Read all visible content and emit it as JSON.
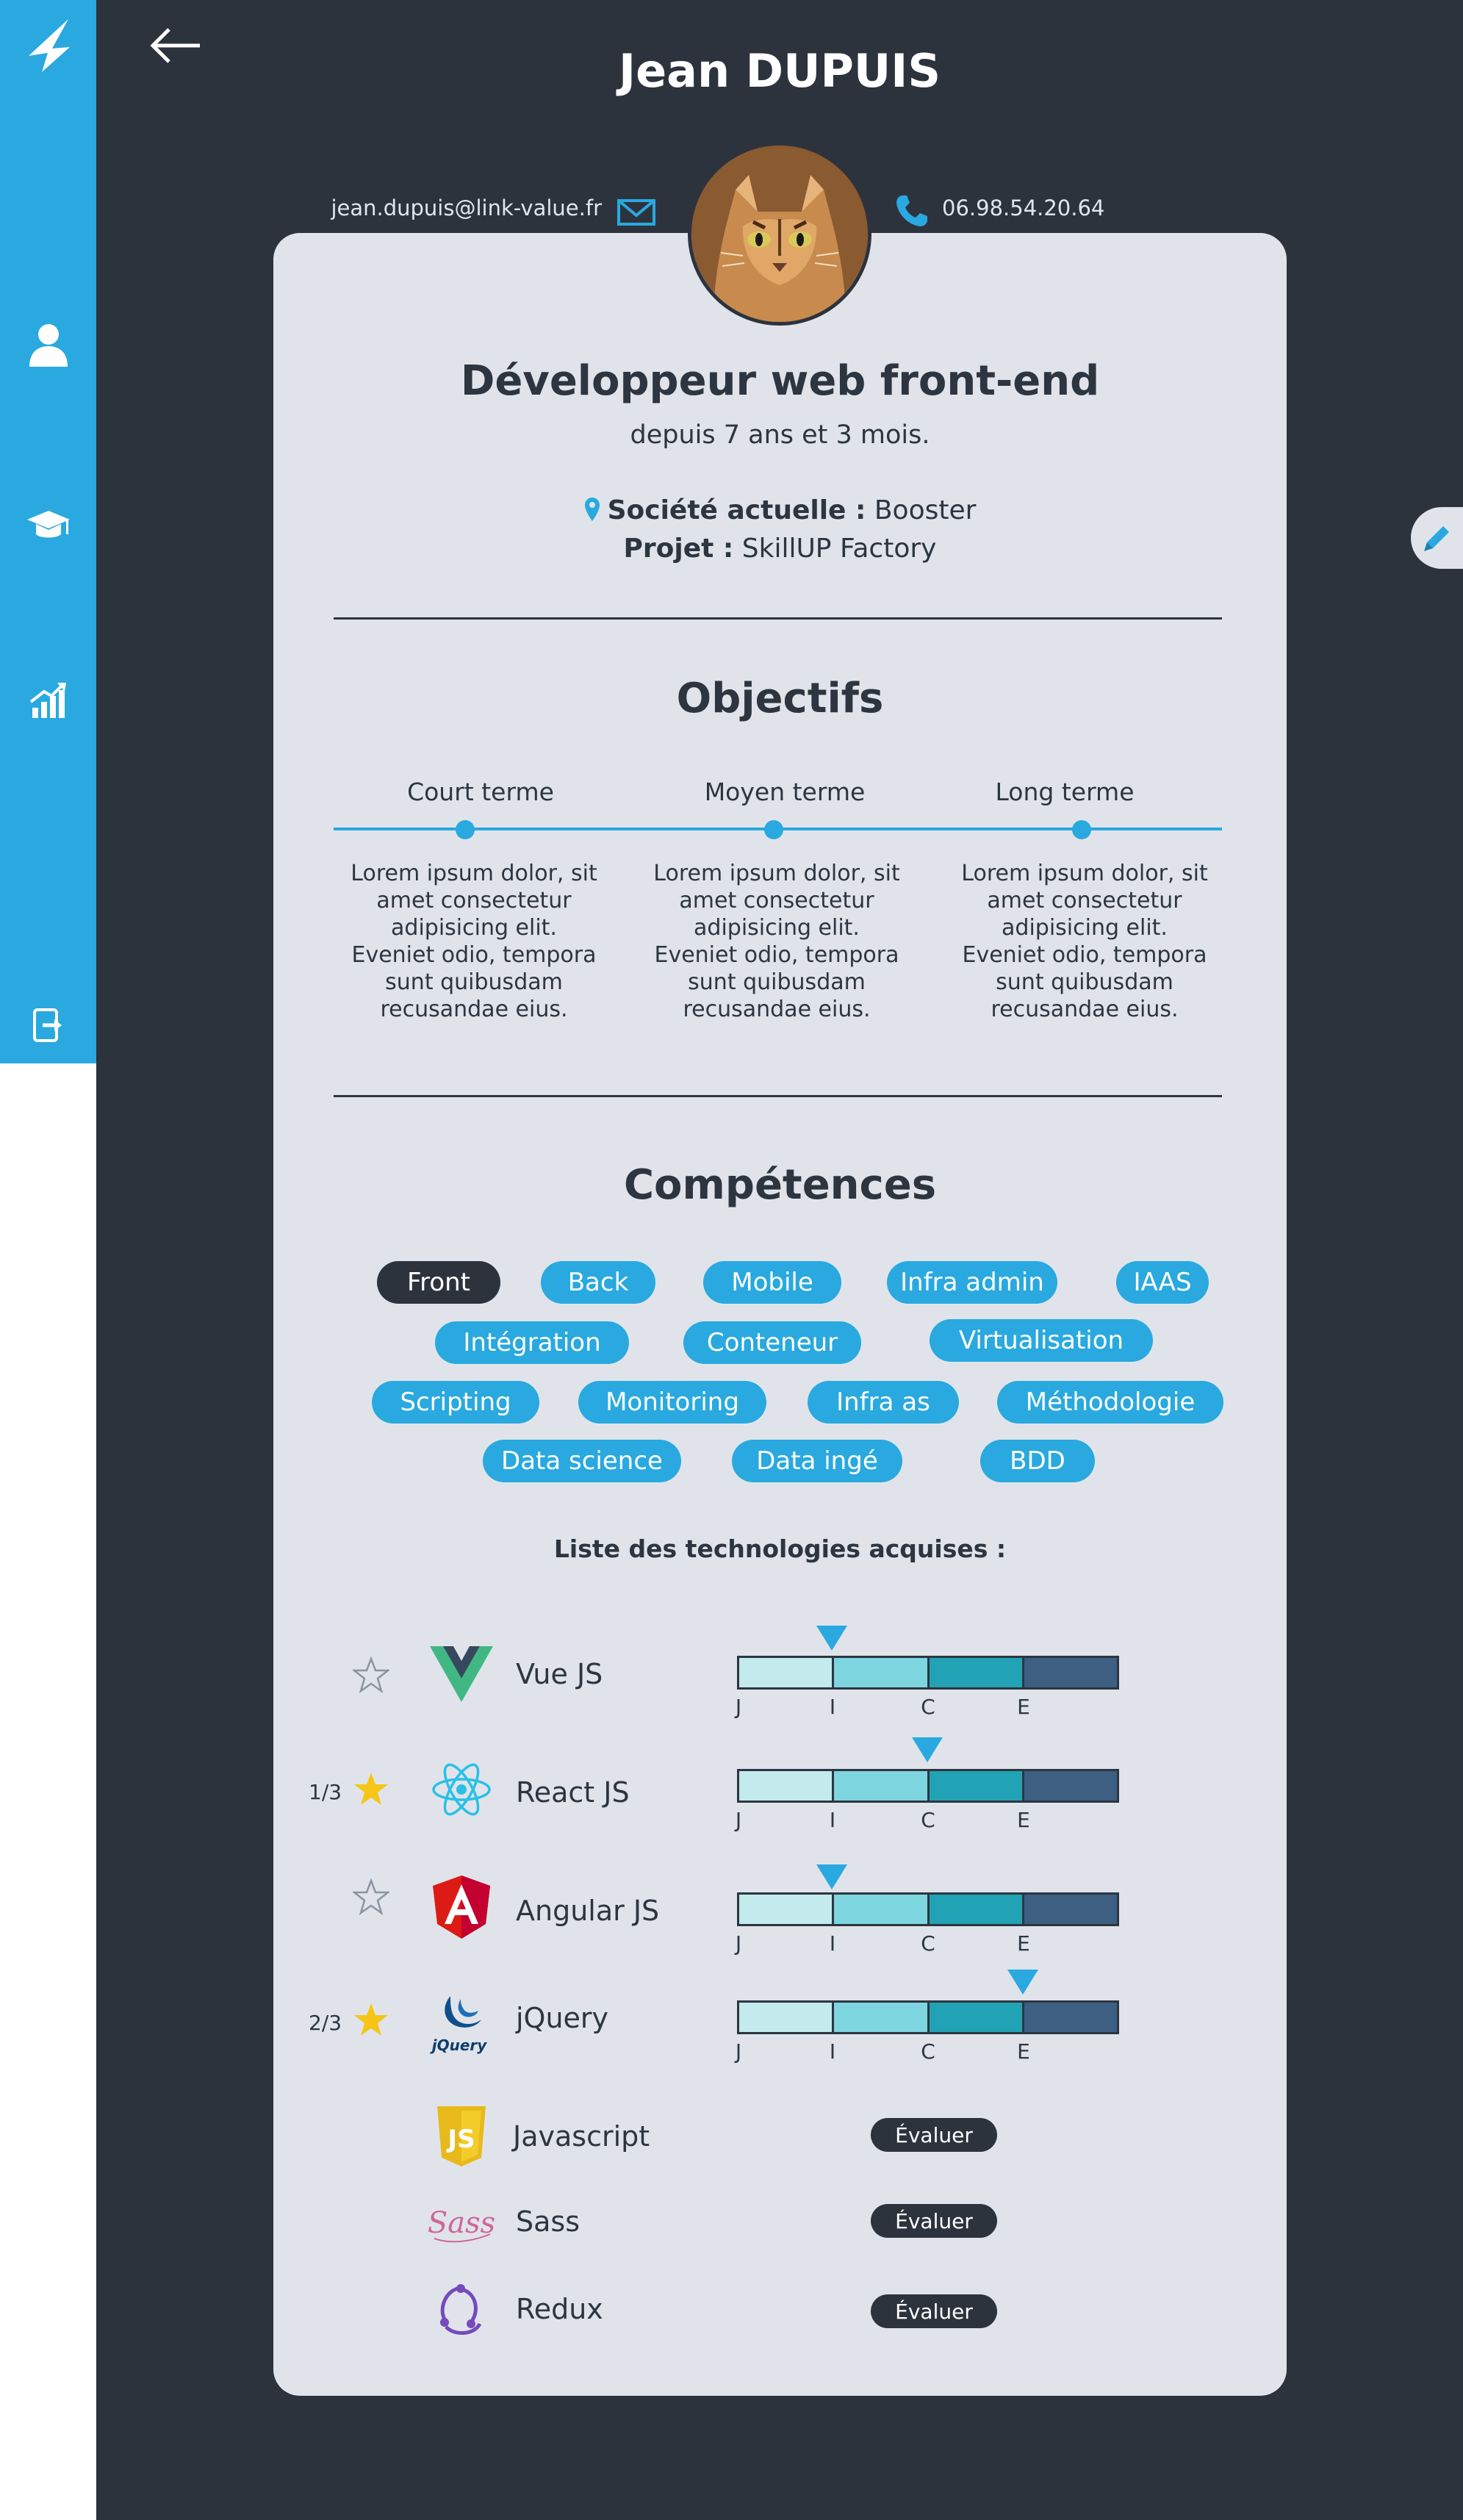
{
  "header": {
    "name": "Jean DUPUIS"
  },
  "contact": {
    "email": "jean.dupuis@link-value.fr",
    "phone": "06.98.54.20.64"
  },
  "profile": {
    "job_title": "Développeur web front-end",
    "experience": "depuis 7 ans et 3 mois.",
    "company_label": "Société actuelle :",
    "company_value": " Booster",
    "project_label": "Projet :",
    "project_value": " SkillUP Factory"
  },
  "objectives": {
    "title": "Objectifs",
    "terms": [
      {
        "label": "Court terme",
        "text": "Lorem ipsum dolor, sit amet consectetur adipisicing elit. Eveniet odio, tempora sunt quibusdam recusandae eius."
      },
      {
        "label": "Moyen terme",
        "text": "Lorem ipsum dolor, sit amet consectetur adipisicing elit. Eveniet odio, tempora sunt quibusdam recusandae eius."
      },
      {
        "label": "Long terme",
        "text": "Lorem ipsum dolor, sit amet consectetur adipisicing elit. Eveniet odio, tempora sunt quibusdam recusandae eius."
      }
    ]
  },
  "skills": {
    "title": "Compétences",
    "categories": [
      "Front",
      "Back",
      "Mobile",
      "Infra admin",
      "IAAS",
      "Intégration",
      "Conteneur",
      "Virtualisation",
      "Scripting",
      "Monitoring",
      "Infra as",
      "Méthodologie",
      "Data science",
      "Data ingé",
      "BDD"
    ],
    "active": "Front"
  },
  "technologies": {
    "title": "Liste des technologies acquises :",
    "level_labels": [
      "J",
      "I",
      "C",
      "E"
    ],
    "evaluate_label": "Évaluer",
    "rated": [
      {
        "name": "Vue JS",
        "icon": "vue-logo-icon",
        "level": 2,
        "favorite": false,
        "fav_count": ""
      },
      {
        "name": "React JS",
        "icon": "react-logo-icon",
        "level": 3,
        "favorite": true,
        "fav_count": "1/3"
      },
      {
        "name": "Angular JS",
        "icon": "angular-logo-icon",
        "level": 2,
        "favorite": false,
        "fav_count": ""
      },
      {
        "name": "jQuery",
        "icon": "jquery-logo-icon",
        "level": 4,
        "favorite": true,
        "fav_count": "2/3"
      }
    ],
    "unrated": [
      {
        "name": "Javascript",
        "icon": "javascript-logo-icon"
      },
      {
        "name": "Sass",
        "icon": "sass-logo-icon"
      },
      {
        "name": "Redux",
        "icon": "redux-logo-icon"
      }
    ],
    "jquery_logo_text": "jQuery"
  },
  "colors": {
    "accent": "#29a9df",
    "dark": "#2d333d",
    "card": "#e0e4ea",
    "star": "#f5c518"
  }
}
